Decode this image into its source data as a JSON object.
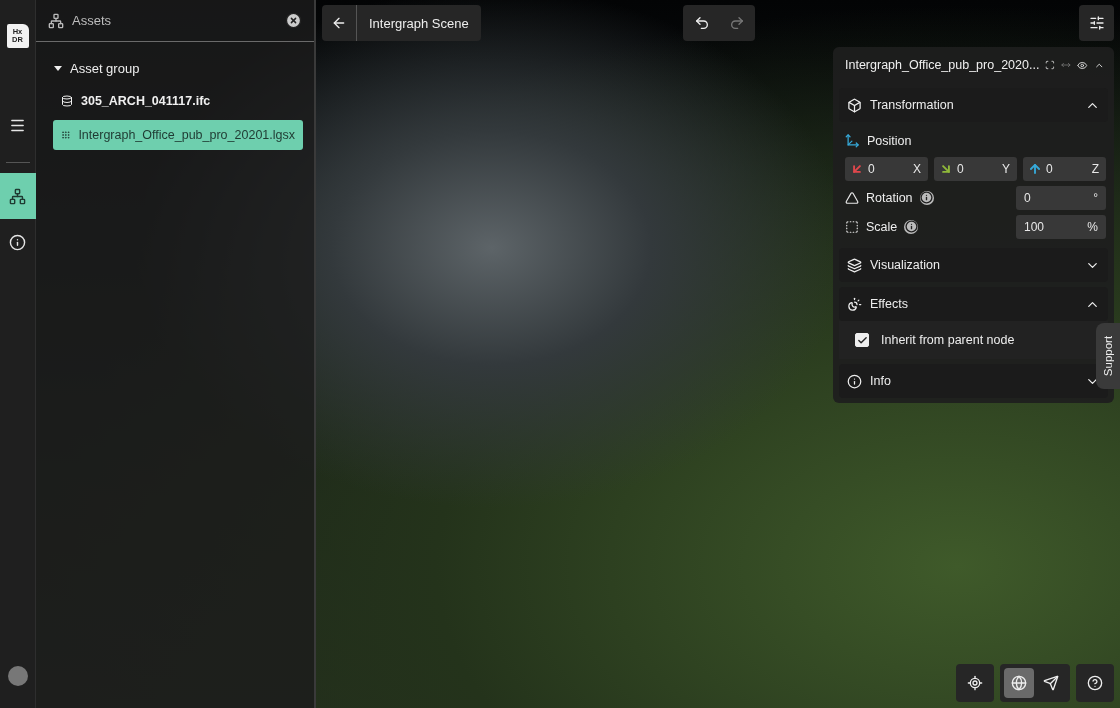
{
  "rail": {
    "logo": [
      "Hx",
      "DR"
    ],
    "items": [
      {
        "kind": "menu",
        "selected": false
      },
      {
        "kind": "tree",
        "selected": true
      },
      {
        "kind": "info",
        "selected": false
      }
    ]
  },
  "assets": {
    "title": "Assets",
    "tree": [
      {
        "label": "Asset group",
        "expanded": true,
        "children": [
          {
            "label": "305_ARCH_041117.ifc",
            "kind": "model",
            "selected": false
          },
          {
            "label": "Intergraph_Office_pub_pro_20201.lgsx",
            "kind": "pointcloud",
            "selected": true
          }
        ]
      }
    ]
  },
  "toolbar": {
    "scene_title": "Intergraph Scene",
    "undo": {
      "disabled": false
    },
    "redo": {
      "disabled": true
    }
  },
  "properties": {
    "title": "Intergraph_Office_pub_pro_2020...",
    "visible": true,
    "sections": [
      {
        "kind": "transformation",
        "title": "Transformation",
        "expanded": true,
        "position": {
          "label": "Position",
          "axes": [
            {
              "value": "0",
              "axis": "X",
              "color": "#e0474c"
            },
            {
              "value": "0",
              "axis": "Y",
              "color": "#8fb83a"
            },
            {
              "value": "0",
              "axis": "Z",
              "color": "#36a9d9"
            }
          ]
        },
        "rotation": {
          "label": "Rotation",
          "value": "0",
          "unit": "°"
        },
        "scale": {
          "label": "Scale",
          "value": "100",
          "unit": "%"
        }
      },
      {
        "kind": "visualization",
        "title": "Visualization",
        "expanded": false
      },
      {
        "kind": "effects",
        "title": "Effects",
        "expanded": true,
        "option": {
          "label": "Inherit from parent node",
          "checked": true
        }
      },
      {
        "kind": "info",
        "title": "Info",
        "expanded": false
      }
    ]
  },
  "support_tab": "Support",
  "view_tools": [
    {
      "kind": "locate",
      "selected": false
    },
    {
      "kind": "globe",
      "selected": true
    },
    {
      "kind": "navigate",
      "selected": false
    },
    {
      "kind": "help",
      "selected": false
    }
  ]
}
